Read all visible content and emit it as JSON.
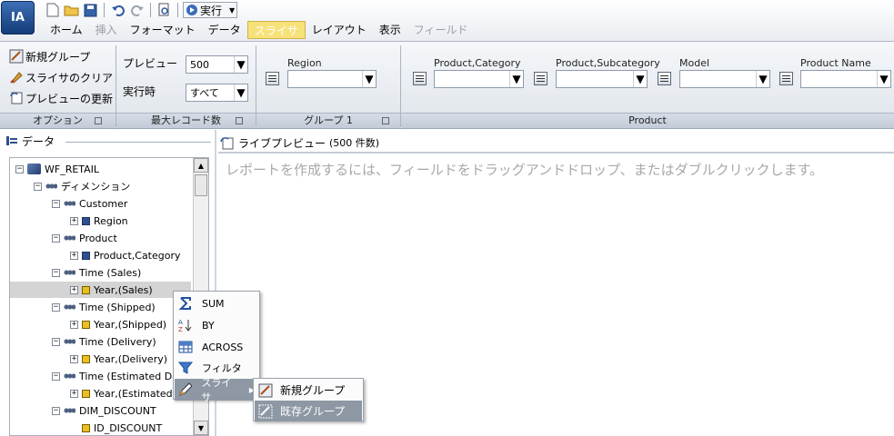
{
  "app": {
    "logo_text": "IA"
  },
  "qat": {
    "run_label": "実行"
  },
  "menu": {
    "tabs": [
      {
        "label": "ホーム",
        "state": "normal"
      },
      {
        "label": "挿入",
        "state": "disabled"
      },
      {
        "label": "フォーマット",
        "state": "normal"
      },
      {
        "label": "データ",
        "state": "normal"
      },
      {
        "label": "スライサ",
        "state": "active"
      },
      {
        "label": "レイアウト",
        "state": "normal"
      },
      {
        "label": "表示",
        "state": "normal"
      },
      {
        "label": "フィールド",
        "state": "disabled"
      }
    ]
  },
  "ribbon": {
    "options": {
      "new_group": "新規グループ",
      "clear_slicer": "スライサのクリア",
      "refresh_preview": "プレビューの更新",
      "group_label": "オプション"
    },
    "max_records": {
      "preview_label": "プレビュー",
      "preview_value": "500",
      "runtime_label": "実行時",
      "runtime_value": "すべて",
      "group_label": "最大レコード数"
    },
    "group1": {
      "field_label": "Region",
      "group_label": "グループ 1"
    },
    "product": {
      "fields": [
        "Product,Category",
        "Product,Subcategory",
        "Model",
        "Product Name"
      ],
      "group_label": "Product"
    }
  },
  "data_panel": {
    "title": "データ"
  },
  "tree": [
    {
      "label": "WF_RETAIL",
      "icon": "cube",
      "toggle": "⊟",
      "indent": 0
    },
    {
      "label": "ディメンション",
      "icon": "dim",
      "toggle": "⊟",
      "indent": 1
    },
    {
      "label": "Customer",
      "icon": "dim",
      "toggle": "⊟",
      "indent": 2
    },
    {
      "label": "Region",
      "icon": "square",
      "toggle": "⊞",
      "indent": 3
    },
    {
      "label": "Product",
      "icon": "dim",
      "toggle": "⊟",
      "indent": 2
    },
    {
      "label": "Product,Category",
      "icon": "square",
      "toggle": "⊞",
      "indent": 3
    },
    {
      "label": "Time (Sales)",
      "icon": "dim",
      "toggle": "⊟",
      "indent": 2
    },
    {
      "label": "Year,(Sales)",
      "icon": "gold",
      "toggle": "⊞",
      "indent": 3,
      "selected": true
    },
    {
      "label": "Time (Shipped)",
      "icon": "dim",
      "toggle": "⊟",
      "indent": 2
    },
    {
      "label": "Year,(Shipped)",
      "icon": "gold",
      "toggle": "⊞",
      "indent": 3
    },
    {
      "label": "Time (Delivery)",
      "icon": "dim",
      "toggle": "⊟",
      "indent": 2
    },
    {
      "label": "Year,(Delivery)",
      "icon": "gold",
      "toggle": "⊞",
      "indent": 3
    },
    {
      "label": "Time (Estimated Deliv",
      "icon": "dim",
      "toggle": "⊟",
      "indent": 2
    },
    {
      "label": "Year,(Estimated",
      "icon": "gold",
      "toggle": "⊞",
      "indent": 3
    },
    {
      "label": "DIM_DISCOUNT",
      "icon": "dim",
      "toggle": "⊟",
      "indent": 2
    },
    {
      "label": "ID_DISCOUNT",
      "icon": "gold",
      "toggle": "",
      "indent": 3
    }
  ],
  "preview": {
    "title": "ライブプレビュー",
    "count": "(500 件数)",
    "message": "レポートを作成するには、フィールドをドラッグアンドドロップ、またはダブルクリックします。"
  },
  "context_menu": {
    "items": [
      {
        "label": "SUM",
        "icon": "sigma-icon"
      },
      {
        "label": "BY",
        "icon": "sort-az-icon"
      },
      {
        "label": "ACROSS",
        "icon": "grid-icon"
      },
      {
        "label": "フィルタ",
        "icon": "funnel-icon"
      },
      {
        "label": "スライサ",
        "icon": "pencil-icon",
        "has_submenu": true
      }
    ]
  },
  "submenu": {
    "items": [
      {
        "label": "新規グループ"
      },
      {
        "label": "既存グループ"
      }
    ]
  }
}
